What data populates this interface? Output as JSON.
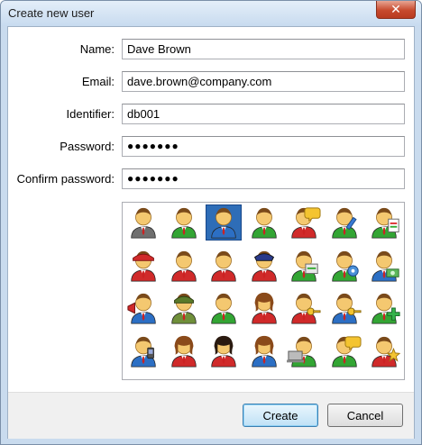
{
  "window": {
    "title": "Create new user",
    "close_glyph": "✕"
  },
  "form": {
    "name_label": "Name:",
    "name_value": "Dave Brown",
    "email_label": "Email:",
    "email_value": "dave.brown@company.com",
    "identifier_label": "Identifier:",
    "identifier_value": "db001",
    "password_label": "Password:",
    "password_value": "●●●●●●●",
    "confirm_label": "Confirm password:",
    "confirm_value": "●●●●●●●"
  },
  "avatars": [
    {
      "name": "avatar-gray-icon",
      "shirt": "#6f6f6f",
      "selected": false,
      "extra": ""
    },
    {
      "name": "avatar-green-icon",
      "shirt": "#33a534",
      "selected": false,
      "extra": ""
    },
    {
      "name": "avatar-blue-icon",
      "shirt": "#2c6fc4",
      "selected": true,
      "extra": ""
    },
    {
      "name": "avatar-green-tie-icon",
      "shirt": "#33a534",
      "selected": false,
      "extra": ""
    },
    {
      "name": "avatar-chat-icon",
      "shirt": "#d02a2a",
      "selected": false,
      "extra": "chat"
    },
    {
      "name": "avatar-edit-icon",
      "shirt": "#33a534",
      "selected": false,
      "extra": "pen"
    },
    {
      "name": "avatar-report-icon",
      "shirt": "#33a534",
      "selected": false,
      "extra": "doc"
    },
    {
      "name": "avatar-cap-icon",
      "shirt": "#d02a2a",
      "selected": false,
      "extra": "cap"
    },
    {
      "name": "avatar-red-icon",
      "shirt": "#d02a2a",
      "selected": false,
      "extra": ""
    },
    {
      "name": "avatar-red-tie-icon",
      "shirt": "#d02a2a",
      "selected": false,
      "extra": ""
    },
    {
      "name": "avatar-police-icon",
      "shirt": "#d02a2a",
      "selected": false,
      "extra": "police"
    },
    {
      "name": "avatar-presenter-icon",
      "shirt": "#33a534",
      "selected": false,
      "extra": "board"
    },
    {
      "name": "avatar-settings-icon",
      "shirt": "#33a534",
      "selected": false,
      "extra": "gear"
    },
    {
      "name": "avatar-money-icon",
      "shirt": "#2c6fc4",
      "selected": false,
      "extra": "money"
    },
    {
      "name": "avatar-megaphone-icon",
      "shirt": "#2c6fc4",
      "selected": false,
      "extra": "mega"
    },
    {
      "name": "avatar-soldier-icon",
      "shirt": "#6f8f3a",
      "selected": false,
      "extra": "soldier"
    },
    {
      "name": "avatar-green-2-icon",
      "shirt": "#33a534",
      "selected": false,
      "extra": ""
    },
    {
      "name": "avatar-woman-icon",
      "shirt": "#d02a2a",
      "selected": false,
      "extra": "woman"
    },
    {
      "name": "avatar-key-icon",
      "shirt": "#d02a2a",
      "selected": false,
      "extra": "key"
    },
    {
      "name": "avatar-key-blue-icon",
      "shirt": "#2c6fc4",
      "selected": false,
      "extra": "key"
    },
    {
      "name": "avatar-add-icon",
      "shirt": "#33a534",
      "selected": false,
      "extra": "plus"
    },
    {
      "name": "avatar-phone-icon",
      "shirt": "#2c6fc4",
      "selected": false,
      "extra": "phone"
    },
    {
      "name": "avatar-woman-red-icon",
      "shirt": "#d02a2a",
      "selected": false,
      "extra": "woman"
    },
    {
      "name": "avatar-woman-dark-icon",
      "shirt": "#d02a2a",
      "selected": false,
      "extra": "darkhair"
    },
    {
      "name": "avatar-woman-blue-icon",
      "shirt": "#2c6fc4",
      "selected": false,
      "extra": "woman"
    },
    {
      "name": "avatar-laptop-icon",
      "shirt": "#33a534",
      "selected": false,
      "extra": "laptop"
    },
    {
      "name": "avatar-comment-icon",
      "shirt": "#33a534",
      "selected": false,
      "extra": "chat"
    },
    {
      "name": "avatar-star-icon",
      "shirt": "#d02a2a",
      "selected": false,
      "extra": "star"
    }
  ],
  "buttons": {
    "create": "Create",
    "cancel": "Cancel"
  }
}
